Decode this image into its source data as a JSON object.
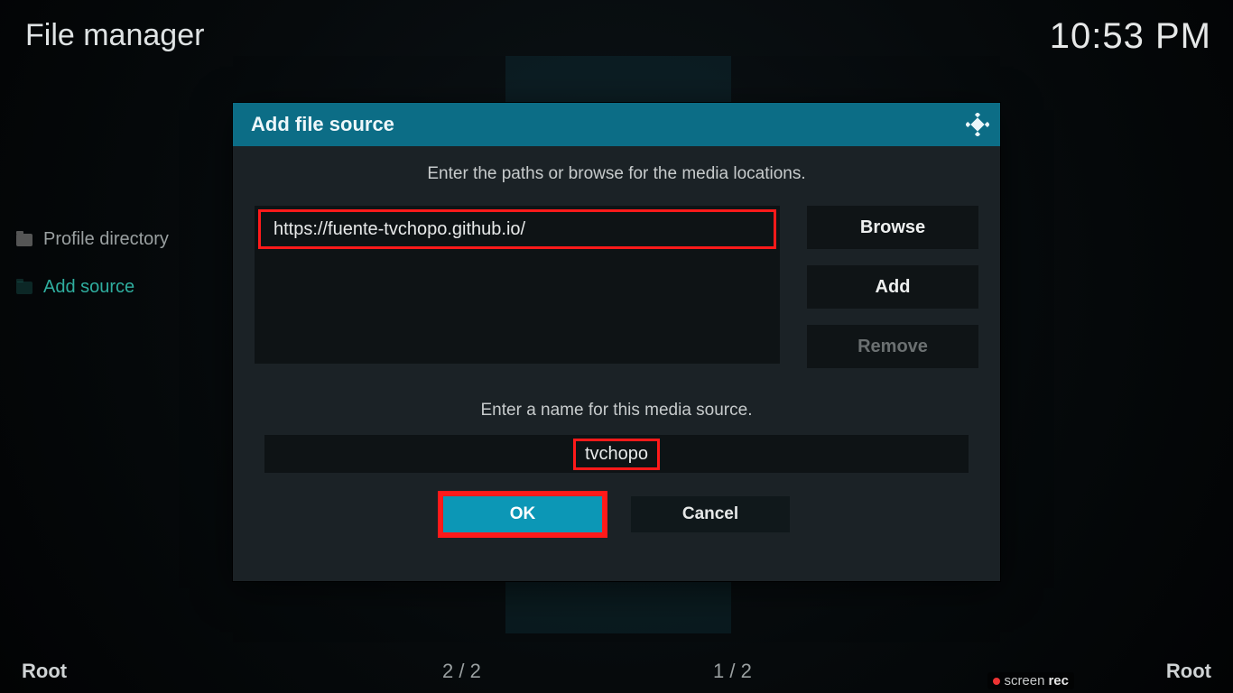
{
  "header": {
    "title": "File manager",
    "time": "10:53 PM"
  },
  "sidebar": {
    "items": [
      {
        "label": "Profile directory",
        "selected": false
      },
      {
        "label": "Add source",
        "selected": true
      }
    ]
  },
  "dialog": {
    "title": "Add file source",
    "logo_name": "kodi-logo",
    "paths_instruction": "Enter the paths or browse for the media locations.",
    "path_value": "https://fuente-tvchopo.github.io/",
    "buttons": {
      "browse": "Browse",
      "add": "Add",
      "remove": "Remove"
    },
    "name_instruction": "Enter a name for this media source.",
    "name_value": "tvchopo",
    "ok_label": "OK",
    "cancel_label": "Cancel"
  },
  "footer": {
    "left": "Root",
    "count_left": "2 / 2",
    "count_right": "1 / 2",
    "right": "Root"
  },
  "watermark": {
    "brand": "screen",
    "suffix": "rec"
  }
}
